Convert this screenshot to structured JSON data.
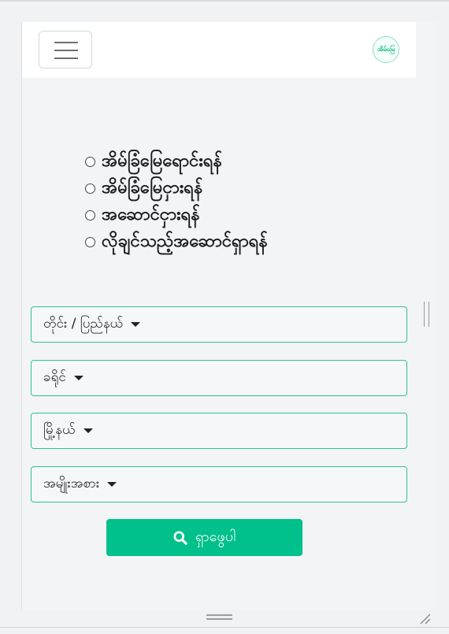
{
  "navbar": {
    "menu_icon": "hamburger-menu-icon",
    "logo_text": "အိမ်မြေ"
  },
  "options": [
    {
      "label": "အိမ်ခြံမြေရောင်းရန်"
    },
    {
      "label": "အိမ်ခြံမြေငှားရန်"
    },
    {
      "label": "အဆောင်ငှားရန်"
    },
    {
      "label": "လိုချင်သည့်အဆောင်ရှာရန်"
    }
  ],
  "filters": {
    "region": "တိုင်း / ပြည်နယ်",
    "district": "ခရိုင်",
    "township": "မြို့နယ်",
    "type": "အမျိုးအစား"
  },
  "search": {
    "label": "ရှာဖွေပါ",
    "icon": "search-icon"
  },
  "colors": {
    "accent": "#00c08b",
    "border": "#2ec38f"
  }
}
